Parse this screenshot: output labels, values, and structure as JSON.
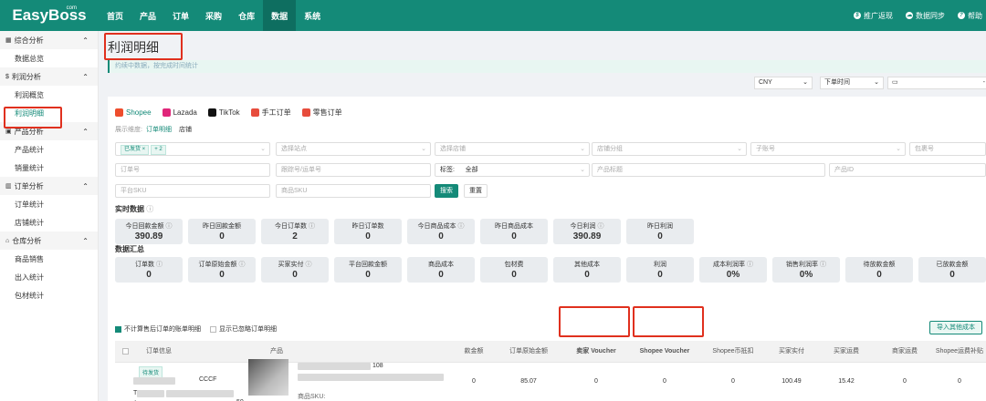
{
  "app": {
    "logo": "EasyBoss",
    "logo_sup": "com"
  },
  "nav": [
    "首页",
    "产品",
    "订单",
    "采购",
    "仓库",
    "数据",
    "系统"
  ],
  "nav_active": "数据",
  "top_right": {
    "promo": "推广返现",
    "sync": "数据同步",
    "help": "帮助"
  },
  "sidebar": {
    "groups": [
      {
        "label": "综合分析",
        "items": [
          "数据总览"
        ]
      },
      {
        "label": "利润分析",
        "items": [
          "利润概览",
          "利润明细"
        ]
      },
      {
        "label": "产品分析",
        "items": [
          "产品统计",
          "销量统计"
        ]
      },
      {
        "label": "订单分析",
        "items": [
          "订单统计",
          "店铺统计"
        ]
      },
      {
        "label": "仓库分析",
        "items": [
          "商品销售",
          "出入统计",
          "包材统计"
        ]
      }
    ],
    "active_item": "利润明细"
  },
  "page": {
    "title": "利润明细",
    "notice": "约续中数据，按完成时间统计"
  },
  "top_selects": {
    "currency": "CNY",
    "time_type": "下单时间",
    "date": ""
  },
  "platforms": [
    "Shopee",
    "Lazada",
    "TikTok",
    "手工订单",
    "零售订单"
  ],
  "dimension": {
    "label": "展示维度:",
    "options": [
      "订单明细",
      "店铺"
    ]
  },
  "filters": {
    "status_tag": "已发货",
    "status_more": "+ 2",
    "site": "选择站点",
    "shop": "选择店铺",
    "shop_group": "店铺分组",
    "sub_account": "子账号",
    "package": "包裹号",
    "order_no": "订单号",
    "tracking": "跟踪号/运单号",
    "tag_label": "标签:",
    "tag_value": "全部",
    "product_title": "产品标题",
    "product_id": "产品ID",
    "platform_sku": "平台SKU",
    "goods_sku": "商品SKU",
    "search_btn": "搜索",
    "reset_btn": "重置"
  },
  "realtime": {
    "title": "实时数据",
    "items": [
      {
        "label": "今日回款金额",
        "value": "390.89",
        "info": true
      },
      {
        "label": "昨日回款金额",
        "value": "0",
        "info": false
      },
      {
        "label": "今日订单数",
        "value": "2",
        "info": true
      },
      {
        "label": "昨日订单数",
        "value": "0",
        "info": false
      },
      {
        "label": "今日商品成本",
        "value": "0",
        "info": true
      },
      {
        "label": "昨日商品成本",
        "value": "0",
        "info": false
      },
      {
        "label": "今日利润",
        "value": "390.89",
        "info": true
      },
      {
        "label": "昨日利润",
        "value": "0",
        "info": false
      }
    ]
  },
  "summary": {
    "title": "数据汇总",
    "items": [
      {
        "label": "订单数",
        "value": "0",
        "info": true
      },
      {
        "label": "订单原始金额",
        "value": "0",
        "info": true
      },
      {
        "label": "买家实付",
        "value": "0",
        "info": true
      },
      {
        "label": "平台回款金额",
        "value": "0",
        "info": false
      },
      {
        "label": "商品成本",
        "value": "0",
        "info": false
      },
      {
        "label": "包材费",
        "value": "0",
        "info": false
      },
      {
        "label": "其他成本",
        "value": "0",
        "info": false
      },
      {
        "label": "利润",
        "value": "0",
        "info": false
      },
      {
        "label": "成本利润率",
        "value": "0%",
        "info": true
      },
      {
        "label": "销售利润率",
        "value": "0%",
        "info": true
      },
      {
        "label": "待放款金额",
        "value": "0",
        "info": false
      },
      {
        "label": "已放款金额",
        "value": "0",
        "info": false
      }
    ]
  },
  "options": {
    "exclude_after_sale": "不计算售后订单的账单明细",
    "show_ignored": "显示已忽略订单明细",
    "import_btn": "导入其他成本"
  },
  "table": {
    "headers": [
      "订单信息",
      "产品",
      "款金额",
      "订单原始金额",
      "卖家 Voucher",
      "Shopee Voucher",
      "Shopee币抵扣",
      "买家实付",
      "买家运费",
      "商家运费",
      "Shopee运费补贴"
    ],
    "row": {
      "status": "待发货",
      "order_frag": "CCCF",
      "order_frag2": "T",
      "order_frag3": "包",
      "order_frag4": "50",
      "prod_frag": "108",
      "sku_label": "商品SKU:",
      "values": [
        "0",
        "85.07",
        "0",
        "0",
        "0",
        "100.49",
        "15.42",
        "0",
        "0"
      ]
    }
  }
}
